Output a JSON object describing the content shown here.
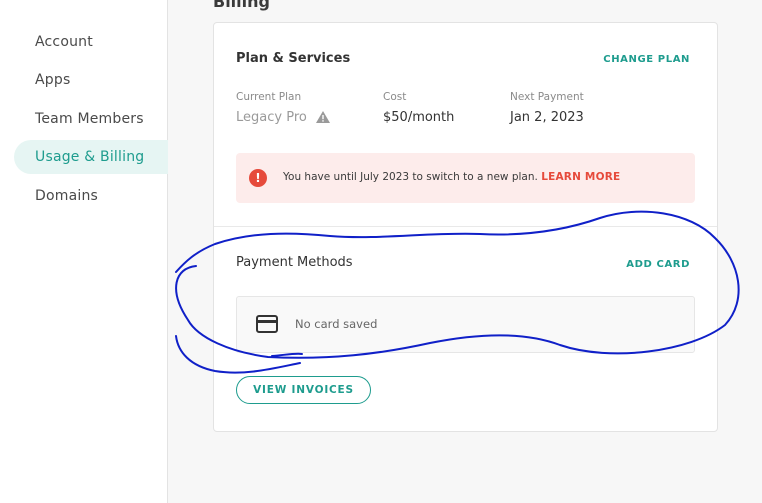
{
  "sidebar": {
    "items": [
      {
        "label": "Account",
        "active": false
      },
      {
        "label": "Apps",
        "active": false
      },
      {
        "label": "Team Members",
        "active": false
      },
      {
        "label": "Usage & Billing",
        "active": true
      },
      {
        "label": "Domains",
        "active": false
      }
    ]
  },
  "page": {
    "section_title": "Billing"
  },
  "plan": {
    "heading": "Plan & Services",
    "change_label": "CHANGE PLAN",
    "current_label": "Current Plan",
    "current_value": "Legacy Pro",
    "current_icon": "warning-triangle-icon",
    "cost_label": "Cost",
    "cost_value": "$50/month",
    "next_label": "Next Payment",
    "next_value": "Jan 2, 2023"
  },
  "alert": {
    "icon": "exclamation-circle-icon",
    "text": "You have until July 2023 to switch to a new plan.",
    "link": "LEARN MORE"
  },
  "payment": {
    "heading": "Payment Methods",
    "add_label": "ADD CARD",
    "icon": "credit-card-icon",
    "empty_text": "No card saved"
  },
  "invoices": {
    "button_label": "VIEW INVOICES"
  },
  "colors": {
    "accent": "#1e9c8e",
    "active_bg": "#e6f5f3",
    "alert_bg": "#fdeceb",
    "alert_red": "#e64a3b",
    "annotation": "#1020c8"
  }
}
